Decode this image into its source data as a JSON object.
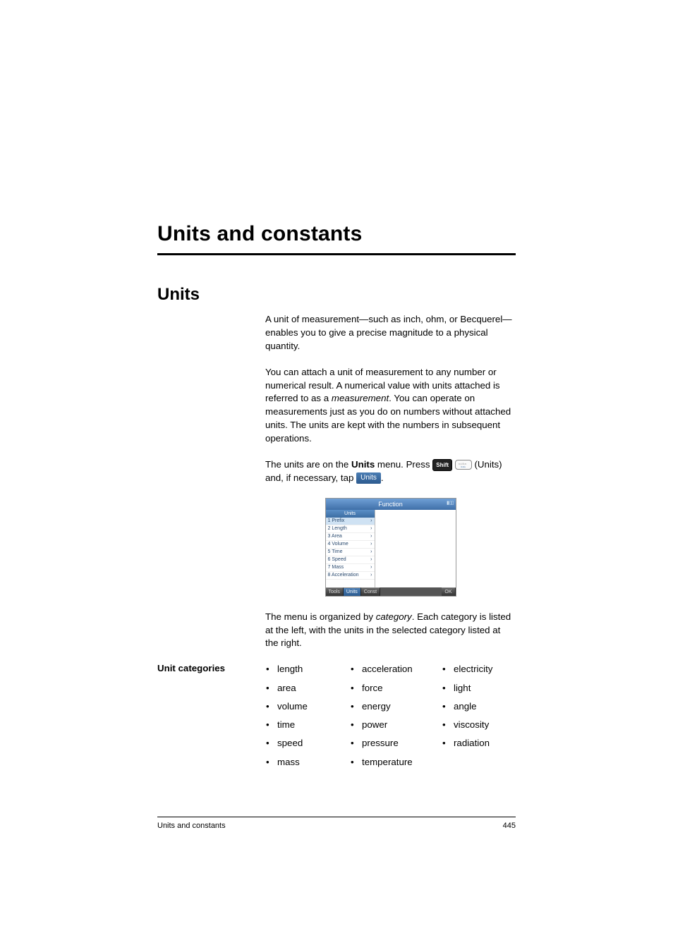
{
  "chapter": {
    "title": "Units and constants"
  },
  "section": {
    "title": "Units"
  },
  "paragraphs": {
    "p1": "A unit of measurement—such as inch, ohm, or Becquerel—enables you to give a precise magnitude to a physical quantity.",
    "p2a": "You can attach a unit of measurement to any number or numerical result. A numerical value with units attached is referred to as a ",
    "p2_em": "measurement",
    "p2b": ". You can operate on measurements just as you do on numbers without attached units. The units are kept with the numbers in subsequent operations.",
    "p3a": "The units are on the ",
    "p3_bold": "Units",
    "p3b": " menu. Press ",
    "p3_keylabel_shift": "Shift",
    "p3_after_keys": " (Units) and, if necessary, tap ",
    "p3_btn": "Units",
    "p3_end": ".",
    "p4a": "The menu is organized by ",
    "p4_em": "category",
    "p4b": ". Each category is listed at the left, with the units in the selected category listed at the right."
  },
  "screenshot": {
    "title": "Function",
    "menu_header": "Units",
    "items": [
      {
        "n": "1",
        "label": "Prefix"
      },
      {
        "n": "2",
        "label": "Length"
      },
      {
        "n": "3",
        "label": "Area"
      },
      {
        "n": "4",
        "label": "Volume"
      },
      {
        "n": "5",
        "label": "Time"
      },
      {
        "n": "6",
        "label": "Speed"
      },
      {
        "n": "7",
        "label": "Mass"
      },
      {
        "n": "8",
        "label": "Acceleration"
      }
    ],
    "tabs": {
      "tools": "Tools",
      "units": "Units",
      "const": "Const",
      "ok": "OK"
    }
  },
  "side_heading": "Unit categories",
  "categories": {
    "col1": [
      "length",
      "area",
      "volume",
      "time",
      "speed",
      "mass"
    ],
    "col2": [
      "acceleration",
      "force",
      "energy",
      "power",
      "pressure",
      "temperature"
    ],
    "col3": [
      "electricity",
      "light",
      "angle",
      "viscosity",
      "radiation"
    ]
  },
  "footer": {
    "left": "Units and constants",
    "right": "445"
  }
}
